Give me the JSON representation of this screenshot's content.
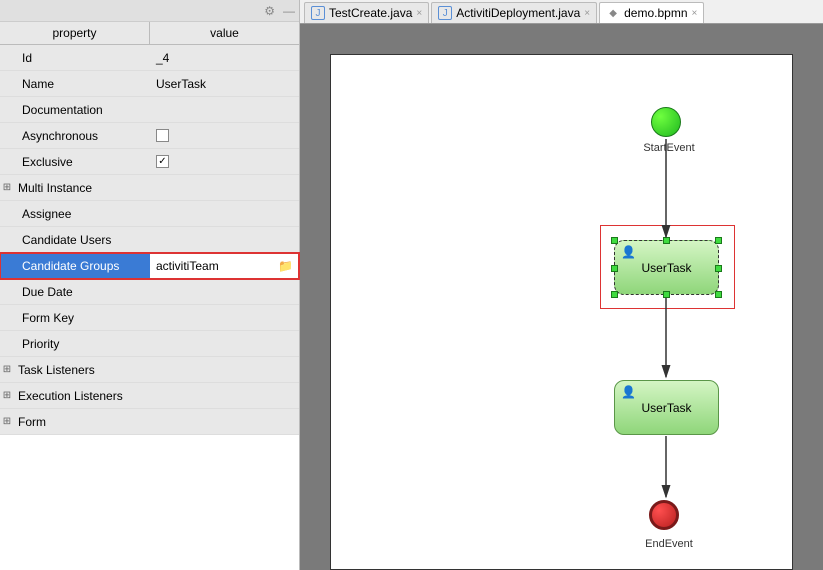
{
  "headers": {
    "property": "property",
    "value": "value"
  },
  "properties": [
    {
      "label": "Id",
      "value": "_4",
      "indent": true
    },
    {
      "label": "Name",
      "value": "UserTask",
      "indent": true
    },
    {
      "label": "Documentation",
      "value": "",
      "indent": true
    },
    {
      "label": "Asynchronous",
      "value": "",
      "indent": true,
      "checkbox": true,
      "checked": false
    },
    {
      "label": "Exclusive",
      "value": "",
      "indent": true,
      "checkbox": true,
      "checked": true
    },
    {
      "label": "Multi Instance",
      "value": "",
      "expandable": true
    },
    {
      "label": "Assignee",
      "value": "",
      "indent": true
    },
    {
      "label": "Candidate Users",
      "value": "",
      "indent": true
    },
    {
      "label": "Candidate Groups",
      "value": "activitiTeam",
      "indent": true,
      "selected": true,
      "browse": true
    },
    {
      "label": "Due Date",
      "value": "",
      "indent": true
    },
    {
      "label": "Form Key",
      "value": "",
      "indent": true
    },
    {
      "label": "Priority",
      "value": "",
      "indent": true
    },
    {
      "label": "Task Listeners",
      "value": "",
      "expandable": true
    },
    {
      "label": "Execution Listeners",
      "value": "",
      "expandable": true
    },
    {
      "label": "Form",
      "value": "",
      "expandable": true
    }
  ],
  "tabs": [
    {
      "label": "TestCreate.java",
      "type": "java",
      "active": false
    },
    {
      "label": "ActivitiDeployment.java",
      "type": "java",
      "active": false
    },
    {
      "label": "demo.bpmn",
      "type": "bpmn",
      "active": true
    }
  ],
  "diagram": {
    "startEvent": "StartEvent",
    "userTask1": "UserTask",
    "userTask2": "UserTask",
    "endEvent": "EndEvent"
  }
}
